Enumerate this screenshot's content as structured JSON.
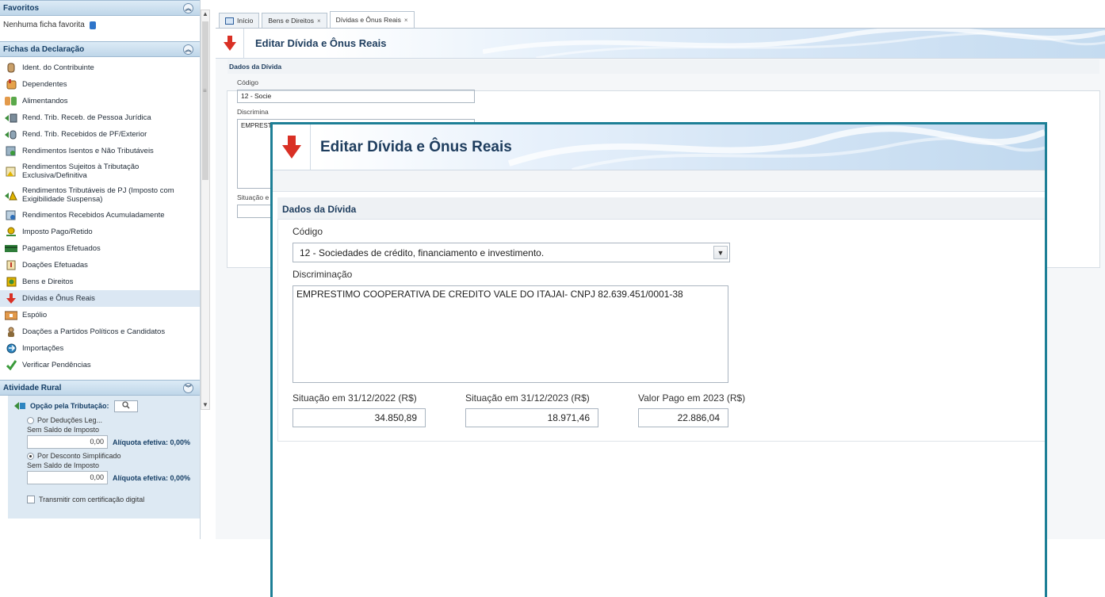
{
  "sidebar": {
    "favoritos": {
      "title": "Favoritos",
      "empty_text": "Nenhuma ficha favorita"
    },
    "fichas": {
      "title": "Fichas da Declaração",
      "items": [
        {
          "label": "Ident. do Contribuinte",
          "icon": "person-icon"
        },
        {
          "label": "Dependentes",
          "icon": "dependents-icon"
        },
        {
          "label": "Alimentandos",
          "icon": "people-icon"
        },
        {
          "label": "Rend. Trib. Receb. de Pessoa Jurídica",
          "icon": "company-income-icon"
        },
        {
          "label": "Rend. Trib. Recebidos de PF/Exterior",
          "icon": "foreign-income-icon"
        },
        {
          "label": "Rendimentos Isentos e Não Tributáveis",
          "icon": "exempt-income-icon"
        },
        {
          "label": "Rendimentos Sujeitos à Tributação Exclusiva/Definitiva",
          "icon": "exclusive-tax-icon"
        },
        {
          "label": "Rendimentos Tributáveis de PJ (Imposto com Exigibilidade Suspensa)",
          "icon": "suspended-tax-icon"
        },
        {
          "label": "Rendimentos Recebidos Acumuladamente",
          "icon": "accumulated-income-icon"
        },
        {
          "label": "Imposto Pago/Retido",
          "icon": "tax-paid-icon"
        },
        {
          "label": "Pagamentos Efetuados",
          "icon": "payments-icon"
        },
        {
          "label": "Doações Efetuadas",
          "icon": "donations-icon"
        },
        {
          "label": "Bens e Direitos",
          "icon": "assets-icon"
        },
        {
          "label": "Dívidas e Ônus Reais",
          "icon": "debt-arrow-icon"
        },
        {
          "label": "Espólio",
          "icon": "estate-icon"
        },
        {
          "label": "Doações a Partidos Políticos e Candidatos",
          "icon": "political-donation-icon"
        },
        {
          "label": "Importações",
          "icon": "imports-icon"
        },
        {
          "label": "Verificar Pendências",
          "icon": "check-icon"
        }
      ]
    },
    "rural": {
      "title": "Atividade Rural",
      "opcao_label": "Opção pela Tributação:",
      "opt1_label": "Por Deduções Leg...",
      "opt1_sub": "Sem Saldo de Imposto",
      "opt1_value": "0,00",
      "opt1_aliq": "Alíquota efetiva: 0,00%",
      "opt2_label": "Por Desconto Simplificado",
      "opt2_sub": "Sem Saldo de Imposto",
      "opt2_value": "0,00",
      "opt2_aliq": "Alíquota efetiva: 0,00%",
      "cert_label": "Transmitir com certificação digital"
    }
  },
  "tabs": [
    {
      "label": "Início",
      "closable": false
    },
    {
      "label": "Bens e Direitos",
      "closable": true
    },
    {
      "label": "Dívidas e Ônus Reais",
      "closable": true
    }
  ],
  "form": {
    "title": "Editar Dívida e Ônus Reais",
    "section_title": "Dados da Dívida",
    "codigo_label": "Código",
    "codigo_value": "12 - Sociedades de crédito, financiamento e investimento.",
    "codigo_value_truncated": "12 - Socie",
    "discriminacao_label": "Discriminação",
    "discriminacao_label_truncated": "Discrimina",
    "discriminacao_value": "EMPRESTIMO COOPERATIVA DE CREDITO VALE DO ITAJAI- CNPJ 82.639.451/0001-38",
    "discriminacao_value_truncated": "EMPREST",
    "situacao_truncated": "Situação e",
    "sit2022_label": "Situação em 31/12/2022 (R$)",
    "sit2022_value": "34.850,89",
    "sit2023_label": "Situação em 31/12/2023 (R$)",
    "sit2023_value": "18.971,46",
    "pago_label": "Valor Pago em 2023 (R$)",
    "pago_value": "22.886,04"
  },
  "colors": {
    "accent": "#1d7f96",
    "header_text": "#1e3d5e",
    "debt_arrow": "#d93025"
  }
}
